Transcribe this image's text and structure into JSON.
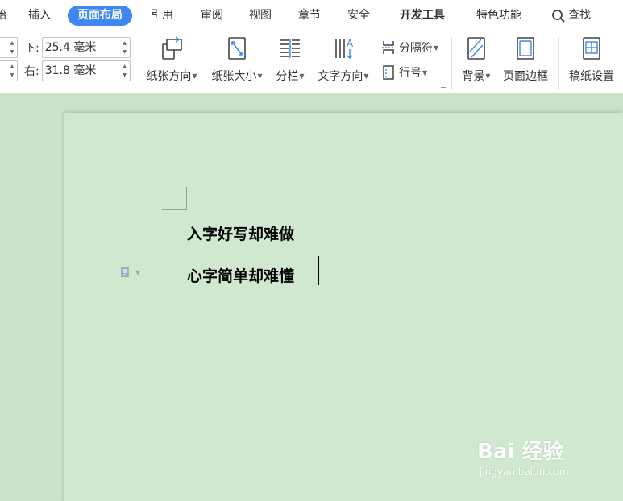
{
  "menu": {
    "tabs": [
      {
        "label": "始",
        "active": false
      },
      {
        "label": "插入",
        "active": false
      },
      {
        "label": "页面布局",
        "active": true
      },
      {
        "label": "引用",
        "active": false
      },
      {
        "label": "审阅",
        "active": false
      },
      {
        "label": "视图",
        "active": false
      },
      {
        "label": "章节",
        "active": false
      },
      {
        "label": "安全",
        "active": false
      },
      {
        "label": "开发工具",
        "active": false
      },
      {
        "label": "特色功能",
        "active": false
      }
    ],
    "search_label": "查找"
  },
  "margins": {
    "bottom_label": "下:",
    "bottom_value": "25.4 毫米",
    "right_label": "右:",
    "right_value": "31.8 毫米"
  },
  "ribbon": {
    "orientation": "纸张方向",
    "size": "纸张大小",
    "columns": "分栏",
    "text_direction": "文字方向",
    "breaks": "分隔符",
    "line_numbers": "行号",
    "background": "背景",
    "page_borders": "页面边框",
    "grid_paper": "稿纸设置"
  },
  "document": {
    "line1": "入字好写却难做",
    "line2": "心字简单却难懂"
  },
  "watermark": {
    "brand": "Bai 经验",
    "url": "jingyan.baidu.com"
  },
  "colors": {
    "accent": "#3e86f0",
    "page_bg": "#cfe8cf",
    "workspace_bg": "#c9e2c9"
  }
}
